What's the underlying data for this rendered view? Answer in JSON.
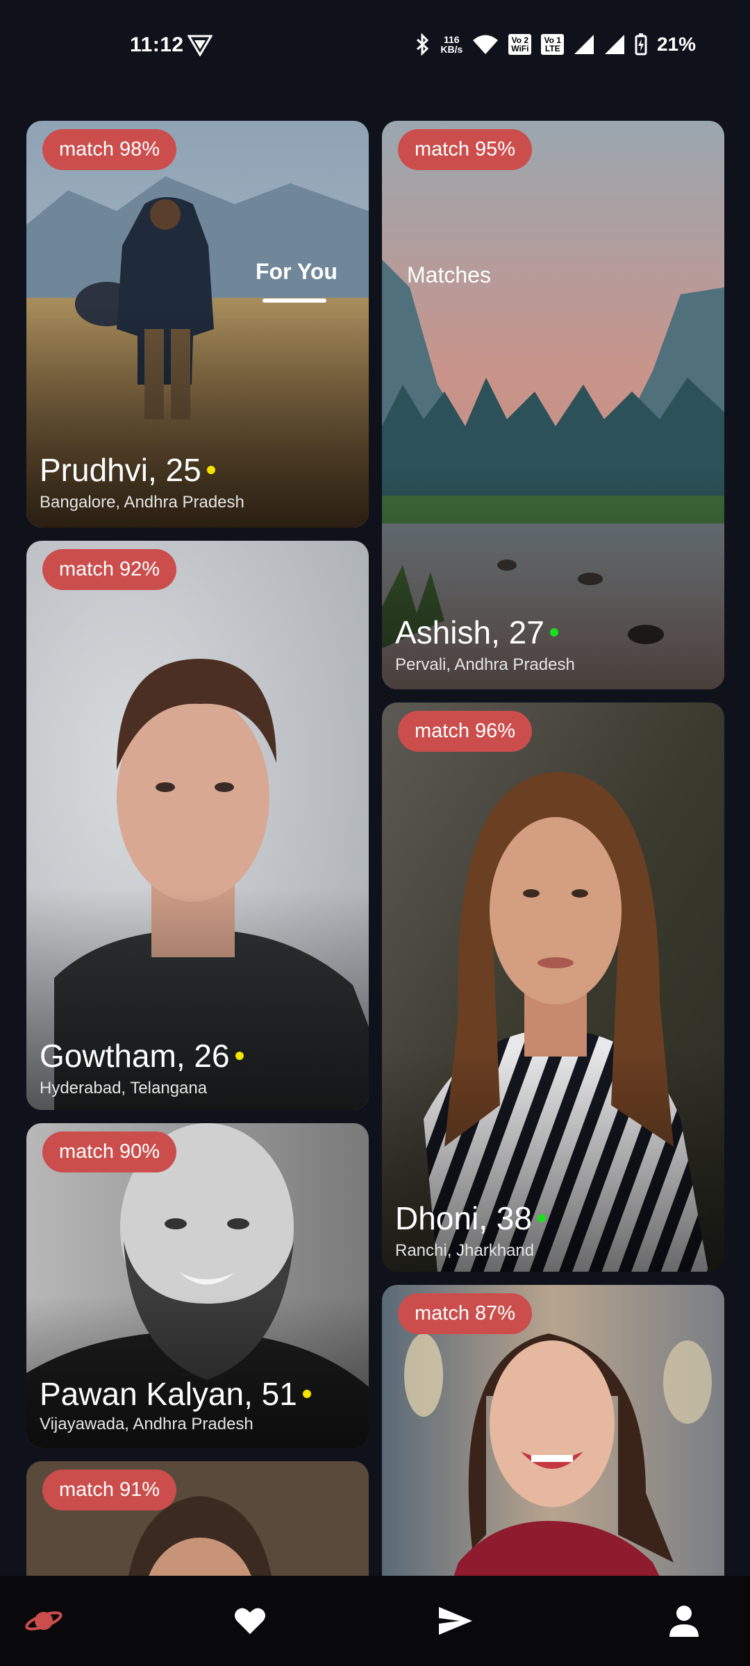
{
  "status_bar": {
    "time": "11:12",
    "speed_value": "116",
    "speed_unit": "KB/s",
    "vowifi_top": "Vo",
    "vowifi_num": "2",
    "vowifi_bottom": "WiFi",
    "volte_top": "Vo",
    "volte_num": "1",
    "volte_bottom": "LTE",
    "battery": "21%"
  },
  "tabs": {
    "for_you": "For You",
    "matches": "Matches",
    "active": "for_you"
  },
  "profiles": [
    {
      "match": "match 98%",
      "name": "Prudhvi, 25",
      "location": "Bangalore, Andhra Pradesh",
      "dot_color": "#f5e400"
    },
    {
      "match": "match 95%",
      "name": "Ashish, 27",
      "location": "Pervali, Andhra Pradesh",
      "dot_color": "#19e01c"
    },
    {
      "match": "match 92%",
      "name": "Gowtham, 26",
      "location": "Hyderabad, Telangana",
      "dot_color": "#f5e400"
    },
    {
      "match": "match 96%",
      "name": "Dhoni, 38",
      "location": "Ranchi, Jharkhand",
      "dot_color": "#19e01c"
    },
    {
      "match": "match 90%",
      "name": "Pawan Kalyan, 51",
      "location": "Vijayawada, Andhra Pradesh",
      "dot_color": "#f5e400"
    },
    {
      "match": "match 87%"
    },
    {
      "match": "match 91%"
    }
  ],
  "nav": {
    "icons": [
      "planet-icon",
      "heart-icon",
      "send-icon",
      "person-icon"
    ],
    "accent": "#cb4e4d"
  }
}
